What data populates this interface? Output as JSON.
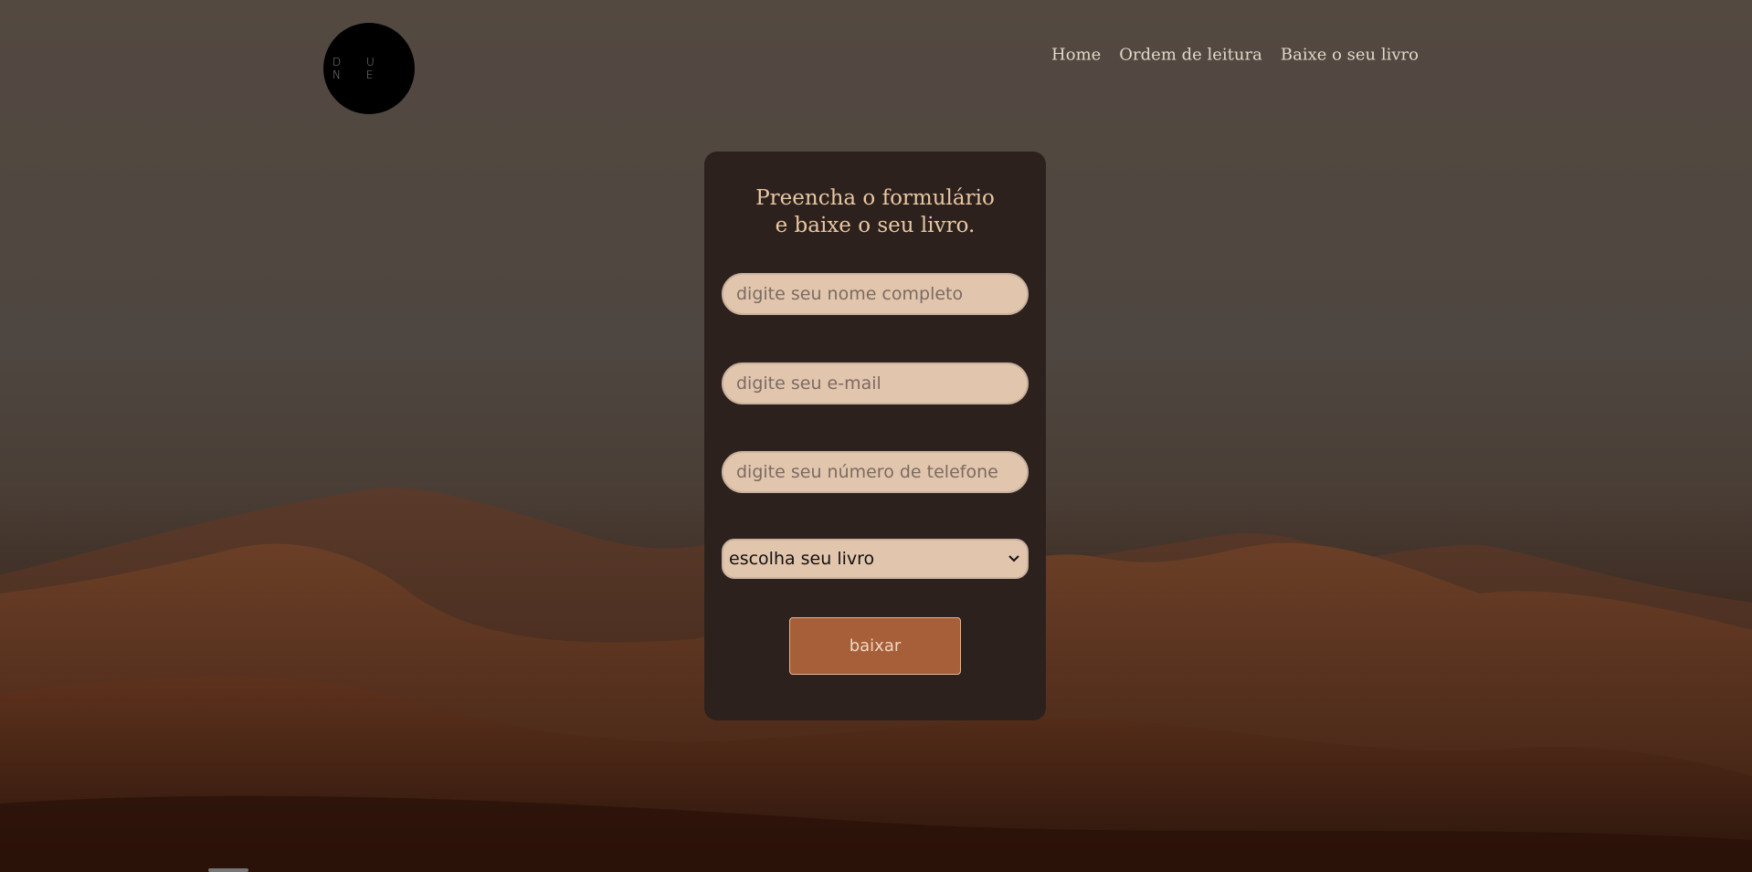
{
  "logo": {
    "text": "D U N E"
  },
  "nav": {
    "items": [
      {
        "label": "Home"
      },
      {
        "label": "Ordem de leitura"
      },
      {
        "label": "Baixe o seu livro"
      }
    ]
  },
  "form": {
    "title": "Preencha o formulário e baixe o seu livro.",
    "name_placeholder": "digite seu nome completo",
    "email_placeholder": "digite seu e-mail",
    "phone_placeholder": "digite seu número de telefone",
    "book_select_value": "escolha seu livro",
    "submit_label": "baixar"
  },
  "colors": {
    "card_bg": "#2d211d",
    "title": "#e8c7a4",
    "field_bg": "#e2c5ad",
    "button_bg": "#a65f39"
  },
  "icons": {
    "select": "chevron-down-icon"
  }
}
